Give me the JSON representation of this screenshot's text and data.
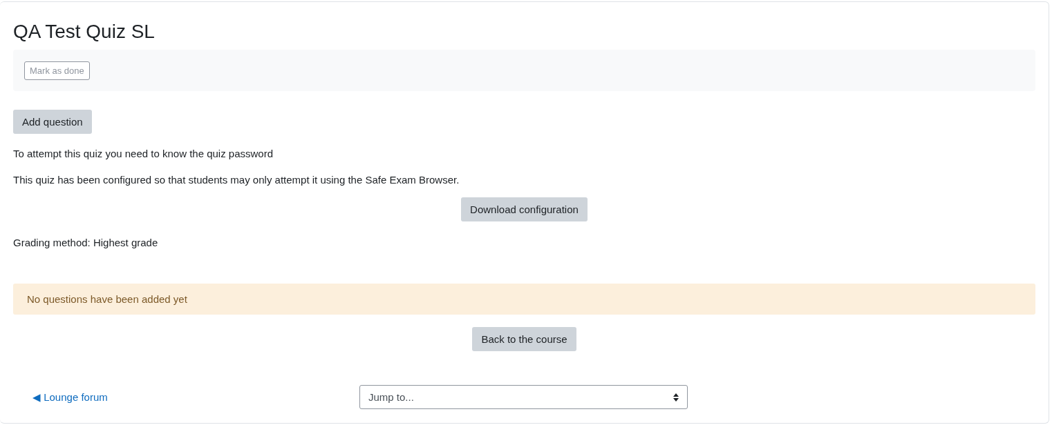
{
  "title": "QA Test Quiz SL",
  "completion": {
    "button": "Mark as done"
  },
  "add_question_button": "Add question",
  "info": [
    "To attempt this quiz you need to know the quiz password",
    "This quiz has been configured so that students may only attempt it using the Safe Exam Browser."
  ],
  "download_button": "Download configuration",
  "grading": "Grading method: Highest grade",
  "alert": "No questions have been added yet",
  "back_button": "Back to the course",
  "footer": {
    "prev_link": "◀ Lounge forum",
    "jump_select": {
      "value": "Jump to..."
    }
  }
}
